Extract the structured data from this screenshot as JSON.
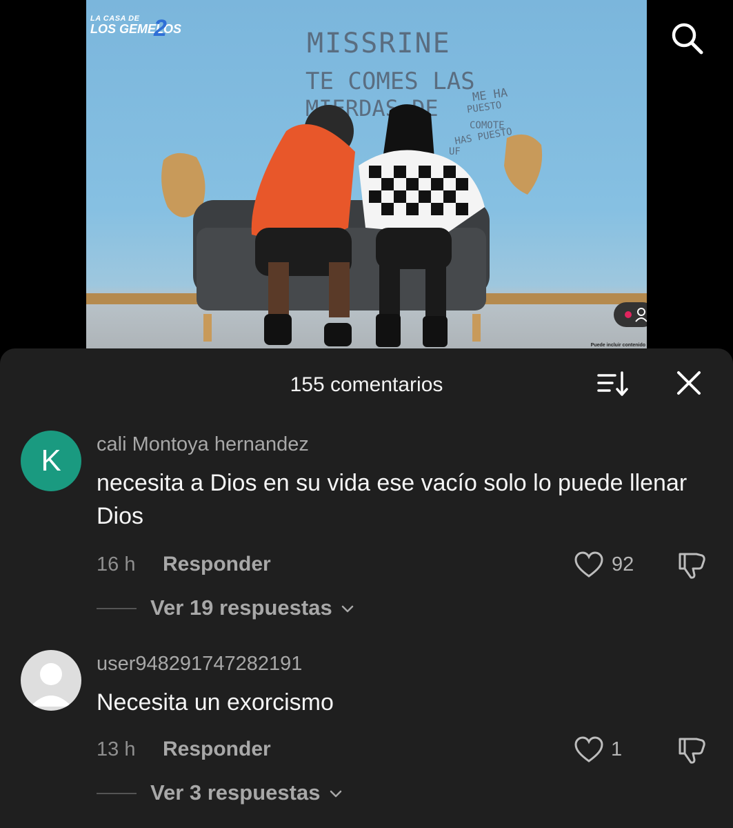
{
  "video": {
    "brand_line1": "LA CASA DE",
    "brand_line2": "LOS GEMELOS",
    "brand_number": "2",
    "wall_text": [
      "MISSRINE",
      "TE COMES LAS",
      "MIERDAS DE",
      "ME HA",
      "PUESTO",
      "COMOTE",
      "HAS PUESTO",
      "UF"
    ],
    "disclaimer": "Puede incluir contenido"
  },
  "header": {
    "count_label": "155 comentarios",
    "sort_icon": "sort-icon",
    "close_icon": "close-icon",
    "search_icon": "search-icon"
  },
  "comments": [
    {
      "avatar_letter": "K",
      "avatar_color": "#1a9a80",
      "username": "cali Montoya hernandez",
      "text": "necesita a Dios en su vida ese vacío solo lo puede llenar Dios",
      "time": "16 h",
      "reply_label": "Responder",
      "likes": "92",
      "view_replies": "Ver 19 respuestas"
    },
    {
      "avatar_letter": "",
      "username": "user948291747282191",
      "text": "Necesita un exorcismo",
      "time": "13 h",
      "reply_label": "Responder",
      "likes": "1",
      "view_replies": "Ver 3 respuestas"
    }
  ],
  "colors": {
    "sheet_bg": "#1f1f1f",
    "accent_avatar": "#1a9a80",
    "live_dot": "#e0245e"
  }
}
